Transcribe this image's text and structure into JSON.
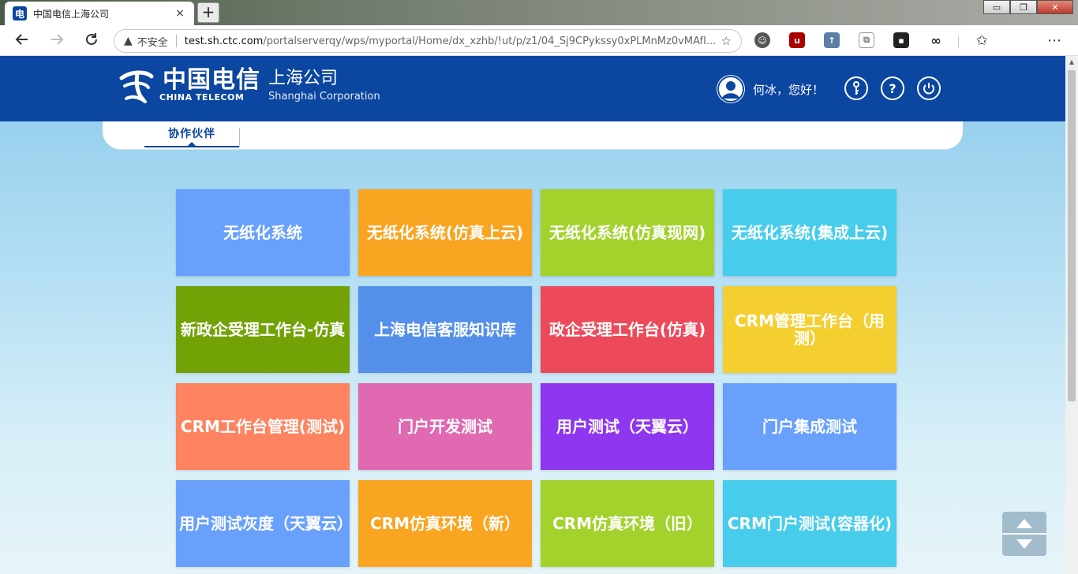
{
  "browser": {
    "tab_title": "中国电信上海公司",
    "tab_favicon": "电",
    "new_tab_label": "+",
    "close_tab_label": "×",
    "security_label": "不安全",
    "url_host": "test.sh.ctc.com",
    "url_path": "/portalserverqy/wps/myportal/Home/dx_xzhb/!ut/p/z1/04_Sj9CPykssy0xPLMnMz0vMAfI...",
    "window_controls": {
      "minimize": "▭",
      "restore": "❐",
      "close": "✕"
    },
    "extensions": [
      "face-extension-icon",
      "ublock-icon",
      "upload-icon",
      "copy-icon",
      "tab-icon",
      "infinity-icon"
    ],
    "icons": {
      "back": "back-arrow-icon",
      "forward": "forward-arrow-icon",
      "reload": "reload-icon",
      "favorites": "favorites-icon",
      "menu": "more-menu-icon"
    }
  },
  "header": {
    "logo_cn": "中国电信",
    "logo_en": "CHINA TELECOM",
    "company_cn": "上海公司",
    "company_en": "Shanghai Corporation",
    "greeting": "何冰，您好！",
    "brand_color": "#0b46a0"
  },
  "nav": {
    "tabs": [
      {
        "label": "协作伙伴",
        "active": true
      }
    ]
  },
  "tiles": [
    {
      "label": "无纸化系统",
      "color": "#68a0fc"
    },
    {
      "label": "无纸化系统(仿真上云)",
      "color": "#f9a522"
    },
    {
      "label": "无纸化系统(仿真现网)",
      "color": "#a3d22c"
    },
    {
      "label": "无纸化系统(集成上云)",
      "color": "#47cdeb"
    },
    {
      "label": "新政企受理工作台-仿真",
      "color": "#72a206"
    },
    {
      "label": "上海电信客服知识库",
      "color": "#5490ea"
    },
    {
      "label": "政企受理工作台(仿真)",
      "color": "#ec4a5a"
    },
    {
      "label": "CRM管理工作台（用测）",
      "color": "#f5cf30"
    },
    {
      "label": "CRM工作台管理(测试)",
      "color": "#fe8360"
    },
    {
      "label": "门户开发测试",
      "color": "#e069b2"
    },
    {
      "label": "用户测试（天翼云）",
      "color": "#8e36f0"
    },
    {
      "label": "门户集成测试",
      "color": "#68a0fc"
    },
    {
      "label": "用户测试灰度（天翼云）",
      "color": "#68a0fc"
    },
    {
      "label": "CRM仿真环境（新）",
      "color": "#f9a522"
    },
    {
      "label": "CRM仿真环境（旧）",
      "color": "#a3d22c"
    },
    {
      "label": "CRM门户测试(容器化)",
      "color": "#47cdeb"
    }
  ]
}
